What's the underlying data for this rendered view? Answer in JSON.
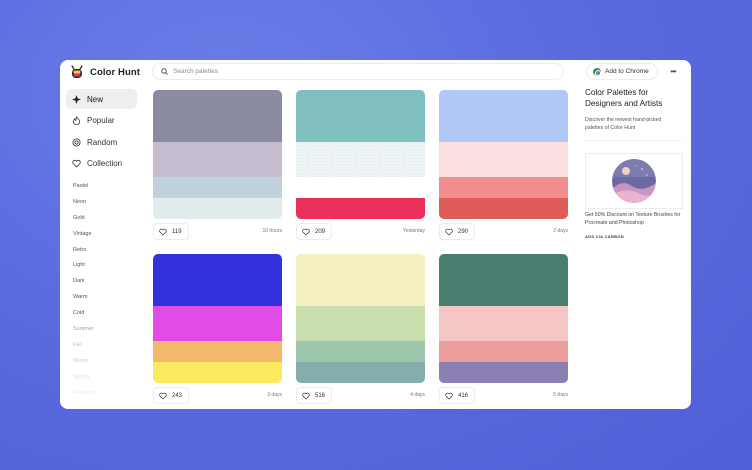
{
  "app": {
    "name": "Color Hunt"
  },
  "search": {
    "placeholder": "Search palettes"
  },
  "header": {
    "chrome_label": "Add to Chrome",
    "more_label": "•••"
  },
  "nav": [
    {
      "id": "new",
      "label": "New",
      "icon": "diamond-icon",
      "active": true
    },
    {
      "id": "popular",
      "label": "Popular",
      "icon": "flame-icon",
      "active": false
    },
    {
      "id": "random",
      "label": "Random",
      "icon": "shuffle-icon",
      "active": false
    },
    {
      "id": "collection",
      "label": "Collection",
      "icon": "heart-icon",
      "active": false
    }
  ],
  "tags": [
    "Pastel",
    "Neon",
    "Gold",
    "Vintage",
    "Retro",
    "Light",
    "Dark",
    "Warm",
    "Cold",
    "Summer",
    "Fall",
    "Winter",
    "Spring",
    "Rainbow"
  ],
  "palettes": [
    {
      "colors": [
        "#8a8aa3",
        "#c6bccf",
        "#bfd1dc",
        "#e2ecef"
      ],
      "likes": "119",
      "time": "10 hours"
    },
    {
      "colors": [
        "#7fbfbf",
        "#eef3f6",
        "#ffffff",
        "#e8305a"
      ],
      "likes": "209",
      "time": "Yesterday"
    },
    {
      "colors": [
        "#b2c8f7",
        "#fcdfdf",
        "#f18d8d",
        "#df5c5a"
      ],
      "likes": "290",
      "time": "2 days"
    },
    {
      "colors": [
        "#3232dc",
        "#e24ce6",
        "#f2b86b",
        "#fbea60"
      ],
      "likes": "243",
      "time": "3 days"
    },
    {
      "colors": [
        "#f5f0c2",
        "#c9dfb0",
        "#9cc7ad",
        "#84aeae"
      ],
      "likes": "516",
      "time": "4 days"
    },
    {
      "colors": [
        "#4a7e70",
        "#f4c6c5",
        "#ec9e9c",
        "#8c7fb4"
      ],
      "likes": "416",
      "time": "5 days"
    }
  ],
  "sidebar_right": {
    "title": "Color Palettes for Designers and Artists",
    "description": "Discover the newest hand-picked palettes of Color Hunt",
    "ad_text": "Get 50% Discount on Texture Brushes for Procreate and Photoshop",
    "ad_via": "ADS VIA CARBON"
  },
  "colors": {
    "accent": "#5a6cdf",
    "active_nav": "#efefef",
    "border": "#ececec"
  }
}
